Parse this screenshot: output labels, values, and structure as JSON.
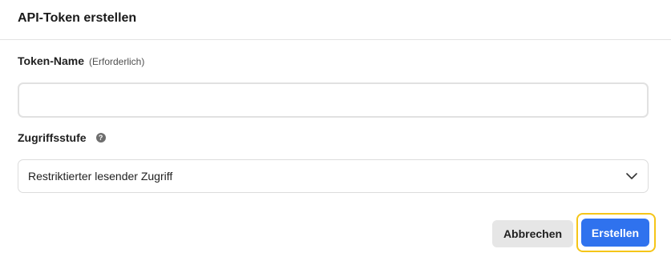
{
  "dialog": {
    "title": "API-Token erstellen"
  },
  "token_name": {
    "label": "Token-Name",
    "hint": "(Erforderlich)",
    "value": "",
    "placeholder": ""
  },
  "access_level": {
    "label": "Zugriffsstufe",
    "help_icon": "question-circle-icon",
    "selected_value": "Restriktierter lesender Zugriff",
    "chevron_icon": "chevron-down-icon"
  },
  "actions": {
    "cancel_label": "Abbrechen",
    "create_label": "Erstellen"
  },
  "colors": {
    "primary": "#2f72ee",
    "focus_ring": "#f5c518",
    "secondary_bg": "#e6e6e6"
  }
}
